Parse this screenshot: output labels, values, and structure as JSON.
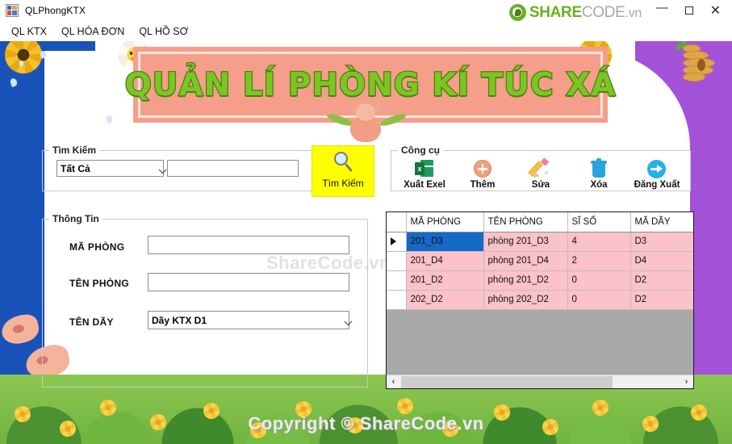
{
  "window": {
    "title": "QLPhongKTX",
    "app_icon": "window-app-icon",
    "minimize": "—",
    "maximize": "□",
    "close": "✕"
  },
  "brand": {
    "share": "SHARE",
    "code": "CODE",
    "vn": ".vn"
  },
  "menu": {
    "items": [
      {
        "label": "QL KTX"
      },
      {
        "label": "QL HÓA ĐƠN"
      },
      {
        "label": "QL HỒ SƠ"
      }
    ]
  },
  "banner": {
    "title": "QUẢN LÍ PHÒNG KÍ TÚC XÁ",
    "bg_color": "#f59e8a",
    "text_color": "#7bc623",
    "outline_color": "#4e7f13"
  },
  "search": {
    "group_label": "Tìm Kiếm",
    "filter_value": "Tất Cả",
    "filter_options": [
      "Tất Cả"
    ],
    "query_value": "",
    "query_placeholder": "",
    "button_label": "Tìm Kiếm",
    "button_color": "#ffff00"
  },
  "tools": {
    "group_label": "Công cụ",
    "items": [
      {
        "label": "Xuất Exel",
        "icon": "excel-icon"
      },
      {
        "label": "Thêm",
        "icon": "plus-circle-icon"
      },
      {
        "label": "Sửa",
        "icon": "pencil-icon"
      },
      {
        "label": "Xóa",
        "icon": "trash-icon"
      },
      {
        "label": "Đăng Xuất",
        "icon": "logout-arrow-icon"
      }
    ]
  },
  "info": {
    "group_label": "Thông Tin",
    "fields": [
      {
        "label": "MÃ PHÒNG",
        "value": ""
      },
      {
        "label": "TÊN PHÒNG",
        "value": ""
      },
      {
        "label": "TÊN DÃY",
        "value": "Dãy KTX D1"
      }
    ],
    "day_options": [
      "Dãy KTX D1"
    ]
  },
  "grid": {
    "columns": [
      "MÃ PHÒNG",
      "TÊN PHÒNG",
      "SĨ SỐ",
      "MÃ DÃY"
    ],
    "rows": [
      {
        "marker": true,
        "ma_phong": "201_D3",
        "ten_phong": "phòng 201_D3",
        "si_so": "4",
        "ma_day": "D3",
        "selected": true
      },
      {
        "marker": false,
        "ma_phong": "201_D4",
        "ten_phong": "phòng 201_D4",
        "si_so": "2",
        "ma_day": "D4",
        "selected": false
      },
      {
        "marker": false,
        "ma_phong": "201_D2",
        "ten_phong": "phòng 201_D2",
        "si_so": "0",
        "ma_day": "D2",
        "selected": false
      },
      {
        "marker": false,
        "ma_phong": "202_D2",
        "ten_phong": "phòng 202_D2",
        "si_so": "0",
        "ma_day": "D2",
        "selected": false
      }
    ],
    "row_bg": "#fbc2ca",
    "selected_bg": "#1569c7",
    "empty_bg": "#a9a9a9",
    "scroll_left": "‹",
    "scroll_right": "›"
  },
  "watermarks": {
    "center": "ShareCode.vn",
    "bottom": "Copyright © ShareCode.vn"
  }
}
